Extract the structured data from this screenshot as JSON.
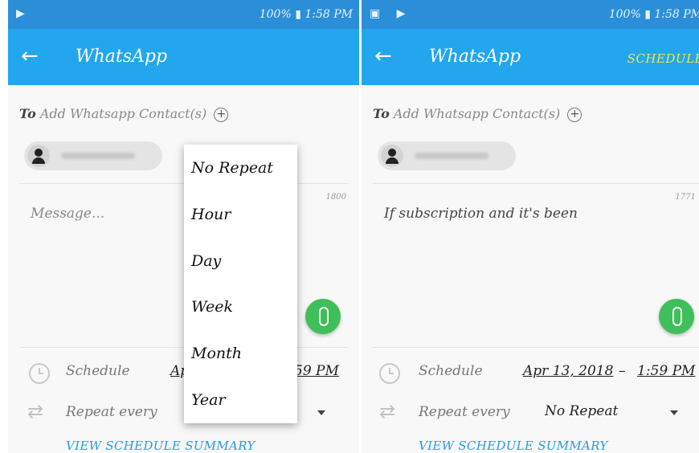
{
  "left": {
    "status_right": "100% ▮ 1:58 PM",
    "title": "WhatsApp",
    "to_label": "To",
    "add_contacts": "Add Whatsapp Contact(s)",
    "char_count": "1800",
    "message_placeholder": "Message...",
    "schedule_label": "Schedule",
    "schedule_date_partial": "Ap",
    "schedule_time_partial": "59 PM",
    "repeat_label": "Repeat every",
    "summary_link": "VIEW SCHEDULE SUMMARY",
    "repeat_options": [
      "No Repeat",
      "Hour",
      "Day",
      "Week",
      "Month",
      "Year"
    ]
  },
  "right": {
    "status_right": "100% ▮ 1:58 PM",
    "title": "WhatsApp",
    "action": "SCHEDULE",
    "to_label": "To",
    "add_contacts": "Add Whatsapp Contact(s)",
    "char_count": "1771",
    "message": "If subscription and it's been",
    "schedule_label": "Schedule",
    "schedule_date": "Apr 13, 2018",
    "schedule_dash": "–",
    "schedule_time": "1:59 PM",
    "repeat_label": "Repeat every",
    "repeat_value": "No Repeat",
    "summary_link": "VIEW SCHEDULE SUMMARY"
  },
  "icons": {
    "back": "arrow-left-icon",
    "add": "plus-circle-icon",
    "attach": "paperclip-icon",
    "clock": "clock-icon",
    "repeat": "repeat-icon",
    "dropdown": "chevron-down-icon"
  },
  "colors": {
    "status_bar": "#2a8fd8",
    "app_bar": "#22a6ee",
    "action": "#f7e34a",
    "fab": "#3fbf59",
    "link": "#2a9be0"
  }
}
